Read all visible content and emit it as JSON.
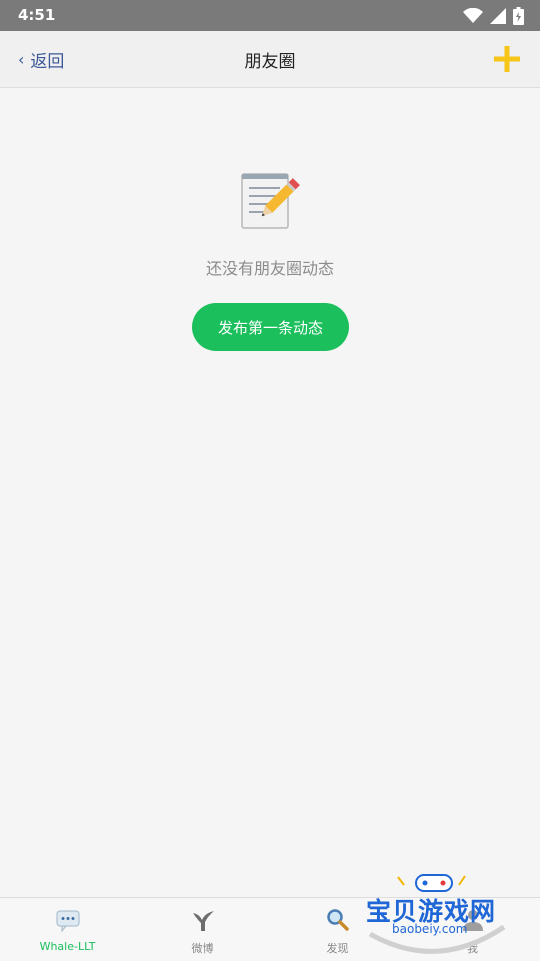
{
  "status_bar": {
    "time": "4:51"
  },
  "nav": {
    "back_label": "返回",
    "title": "朋友圈"
  },
  "empty": {
    "message": "还没有朋友圈动态",
    "button_label": "发布第一条动态"
  },
  "tabs": [
    {
      "label": "Whale-LLT",
      "active": true
    },
    {
      "label": "微博",
      "active": false
    },
    {
      "label": "发现",
      "active": false
    },
    {
      "label": "我",
      "active": false
    }
  ],
  "watermark": {
    "title": "宝贝游戏网",
    "url": "baobeiy.com"
  },
  "colors": {
    "accent_green": "#1bbf5c",
    "back_blue": "#3b5998",
    "add_yellow": "#f5c518"
  }
}
